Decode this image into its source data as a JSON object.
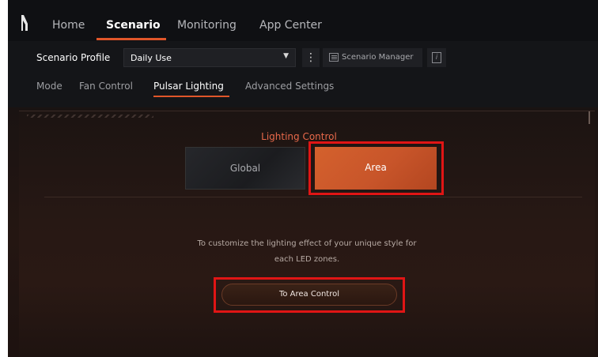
{
  "nav": {
    "tabs": [
      {
        "label": "Home",
        "active": false
      },
      {
        "label": "Scenario",
        "active": true
      },
      {
        "label": "Monitoring",
        "active": false
      },
      {
        "label": "App Center",
        "active": false
      }
    ]
  },
  "profile": {
    "label": "Scenario Profile",
    "selected": "Daily Use",
    "manager_label": "Scenario Manager"
  },
  "subtabs": [
    {
      "label": "Mode",
      "active": false
    },
    {
      "label": "Fan Control",
      "active": false
    },
    {
      "label": "Pulsar Lighting",
      "active": true
    },
    {
      "label": "Advanced Settings",
      "active": false
    }
  ],
  "lighting": {
    "title": "Lighting Control",
    "options": [
      {
        "label": "Global",
        "selected": false
      },
      {
        "label": "Area",
        "selected": true
      }
    ],
    "description_line1": "To customize the lighting effect of your unique style for",
    "description_line2": "each LED zones.",
    "action_label": "To Area Control"
  },
  "colors": {
    "accent": "#e0562a",
    "highlight_box": "#e01515",
    "title_orange": "#e8694a"
  }
}
